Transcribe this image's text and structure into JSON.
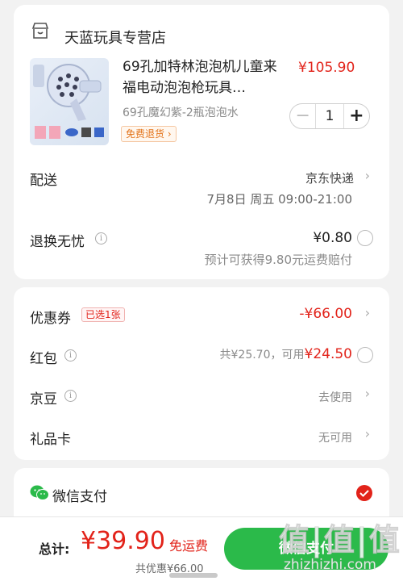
{
  "store": {
    "name": "天蓝玩具专营店",
    "product": {
      "title": "69孔加特林泡泡机儿童来福电动泡泡枪玩具…",
      "price": "¥105.90",
      "variant": "69孔魔幻紫-2瓶泡泡水",
      "tag": "免费退货",
      "quantity": "1"
    },
    "delivery": {
      "label": "配送",
      "carrier": "京东快递",
      "time": "7月8日 周五 09:00-21:00"
    },
    "return_insurance": {
      "label": "退换无忧",
      "price": "¥0.80",
      "note": "预计可获得9.80元运费赔付"
    }
  },
  "discounts": {
    "coupon": {
      "label": "优惠券",
      "badge": "已选1张",
      "value": "-¥66.00"
    },
    "red_packet": {
      "label": "红包",
      "prefix": "共¥25.70，可用",
      "available": "¥24.50"
    },
    "jd_bean": {
      "label": "京豆",
      "value": "去使用"
    },
    "gift_card": {
      "label": "礼品卡",
      "value": "无可用"
    }
  },
  "payment": {
    "method": "微信支付"
  },
  "bottom": {
    "total_label": "总计:",
    "total_amount": "¥39.90",
    "shipping": "免运费",
    "saved": "共优惠¥66.00",
    "pay_button": "微信支付"
  },
  "watermark": {
    "main": "值|值|值",
    "site": "zhizhizhi.com"
  },
  "colors": {
    "accent_red": "#e2231a",
    "wechat_green": "#2bba4a"
  }
}
